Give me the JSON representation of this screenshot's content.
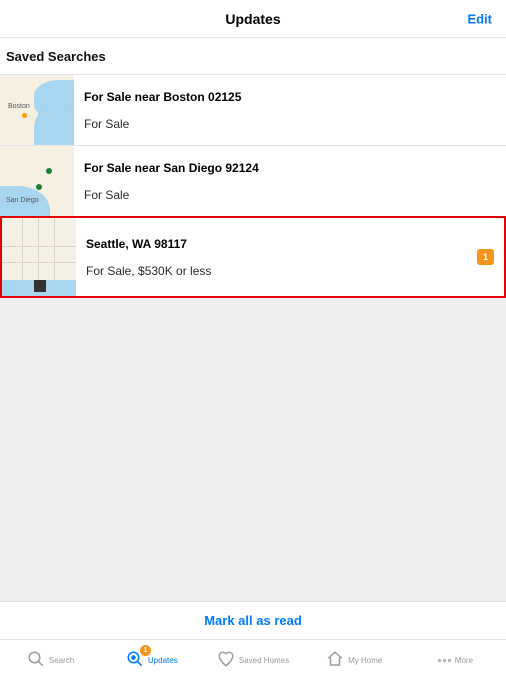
{
  "header": {
    "title": "Updates",
    "edit_label": "Edit"
  },
  "section": {
    "title": "Saved Searches"
  },
  "searches": [
    {
      "title": "For Sale near Boston 02125",
      "subtitle": "For Sale",
      "badge": null,
      "highlighted": false,
      "map": "boston"
    },
    {
      "title": "For Sale near San Diego 92124",
      "subtitle": "For Sale",
      "badge": null,
      "highlighted": false,
      "map": "sandiego"
    },
    {
      "title": "Seattle, WA 98117",
      "subtitle": "For Sale, $530K or less",
      "badge": "1",
      "highlighted": true,
      "map": "seattle"
    }
  ],
  "footer": {
    "mark_all": "Mark all as read"
  },
  "tabs": {
    "search": "Search",
    "updates": "Updates",
    "updates_badge": "1",
    "saved_homes": "Saved Homes",
    "my_home": "My Home",
    "more": "More"
  }
}
